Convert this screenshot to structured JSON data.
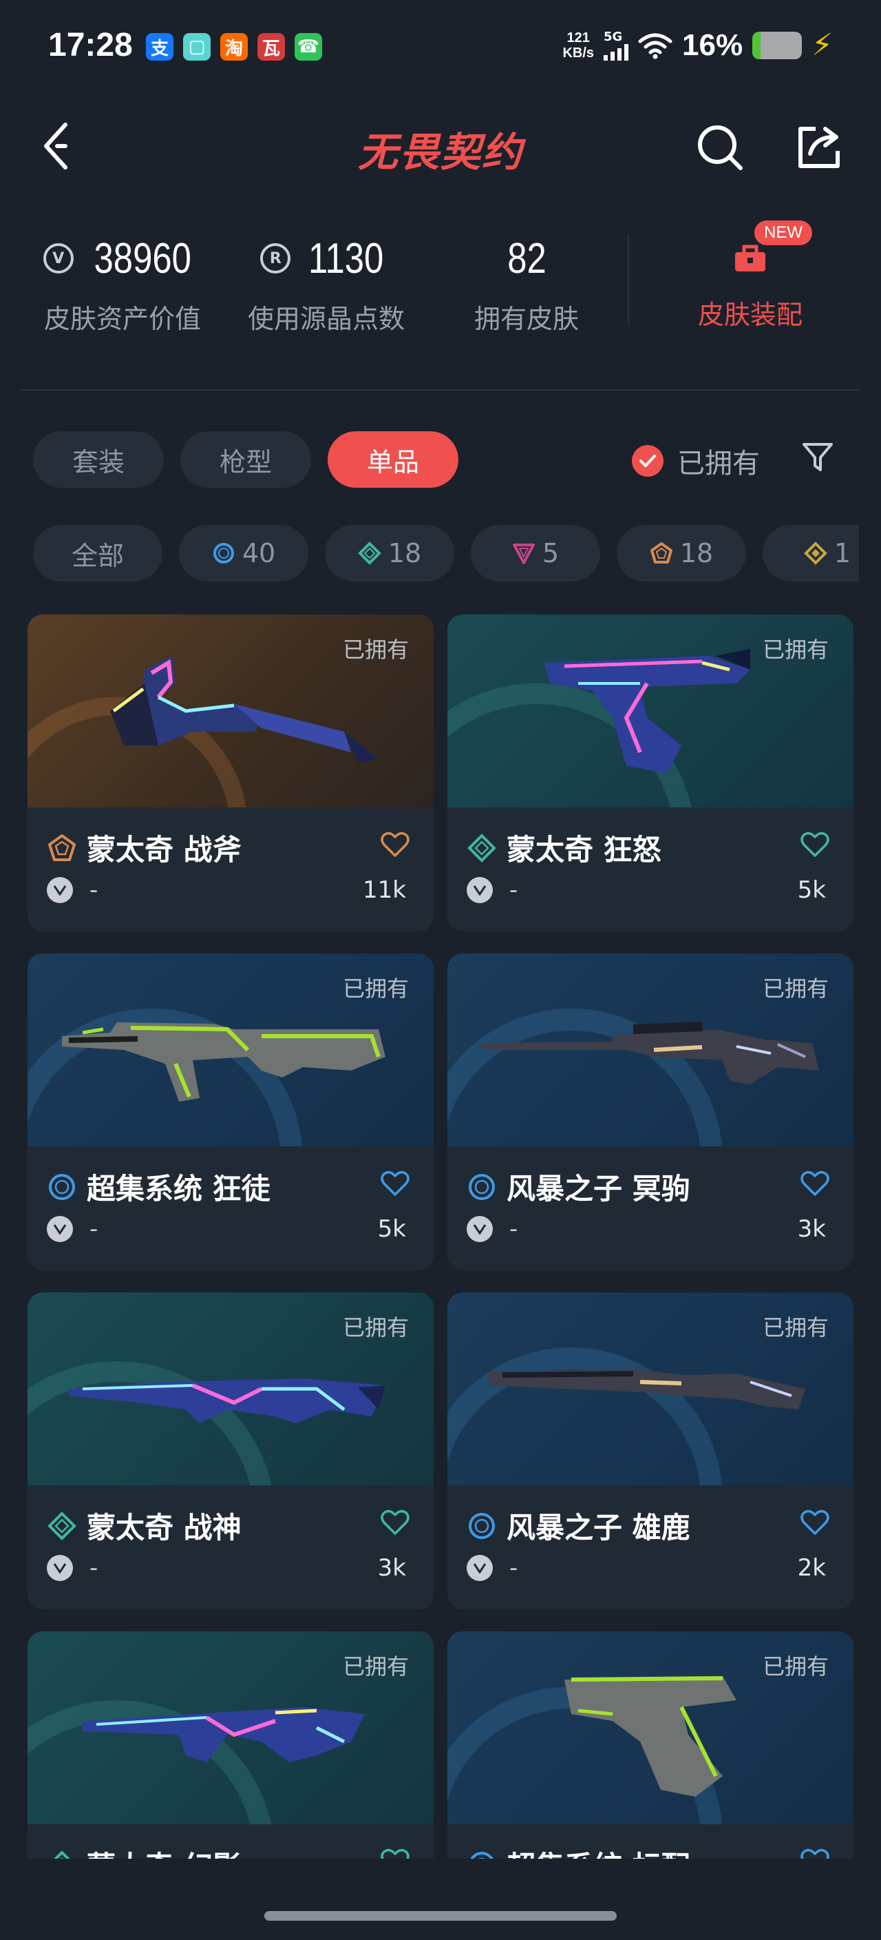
{
  "status_bar": {
    "time": "17:28",
    "notif_icons": [
      {
        "name": "alipay-icon",
        "glyph": "支",
        "color": "#1677ff"
      },
      {
        "name": "app-square-icon",
        "glyph": "▢",
        "color": "#5ad4d0"
      },
      {
        "name": "taobao-icon",
        "glyph": "淘",
        "color": "#ff6a00"
      },
      {
        "name": "game-app-icon",
        "glyph": "瓦",
        "color": "#d43b3b"
      },
      {
        "name": "phone-app-icon",
        "glyph": "☎",
        "color": "#2fc35a"
      }
    ],
    "net_speed_value": "121",
    "net_speed_unit": "KB/s",
    "signal_label": "5G",
    "battery_pct": "16%",
    "battery_level": 0.16
  },
  "header": {
    "title": "无畏契约"
  },
  "stats": {
    "asset_value": "38960",
    "asset_label": "皮肤资产价值",
    "points_value": "1130",
    "points_label": "使用源晶点数",
    "owned_value": "82",
    "owned_label": "拥有皮肤",
    "loadout_label": "皮肤装配",
    "new_badge": "NEW"
  },
  "tabs": [
    {
      "label": "套装",
      "active": false
    },
    {
      "label": "枪型",
      "active": false
    },
    {
      "label": "单品",
      "active": true
    }
  ],
  "owned_filter": {
    "label": "已拥有",
    "checked": true
  },
  "chips": [
    {
      "label": "全部",
      "tier": "all"
    },
    {
      "label": "40",
      "tier": "blue"
    },
    {
      "label": "18",
      "tier": "green"
    },
    {
      "label": "5",
      "tier": "pink"
    },
    {
      "label": "18",
      "tier": "orange"
    },
    {
      "label": "1",
      "tier": "gold"
    }
  ],
  "colors": {
    "accent": "#f0504e",
    "blue_tier": "#3e9be8",
    "green_tier": "#3fb8a3",
    "pink_tier": "#c5468c",
    "orange_tier": "#d98a4e",
    "gold_tier": "#c7a73e"
  },
  "cards": [
    {
      "title": "蒙太奇 战斧",
      "owned": "已拥有",
      "price": "-",
      "likes": "11k",
      "tier": "orange"
    },
    {
      "title": "蒙太奇 狂怒",
      "owned": "已拥有",
      "price": "-",
      "likes": "5k",
      "tier": "green"
    },
    {
      "title": "超集系统 狂徒",
      "owned": "已拥有",
      "price": "-",
      "likes": "5k",
      "tier": "blue"
    },
    {
      "title": "风暴之子 冥驹",
      "owned": "已拥有",
      "price": "-",
      "likes": "3k",
      "tier": "blue"
    },
    {
      "title": "蒙太奇 战神",
      "owned": "已拥有",
      "price": "-",
      "likes": "3k",
      "tier": "green"
    },
    {
      "title": "风暴之子 雄鹿",
      "owned": "已拥有",
      "price": "-",
      "likes": "2k",
      "tier": "blue"
    },
    {
      "title": "蒙太奇 幻影",
      "owned": "已拥有",
      "price": "",
      "likes": "",
      "tier": "green"
    },
    {
      "title": "超集系统 标配",
      "owned": "已拥有",
      "price": "",
      "likes": "",
      "tier": "blue"
    }
  ]
}
